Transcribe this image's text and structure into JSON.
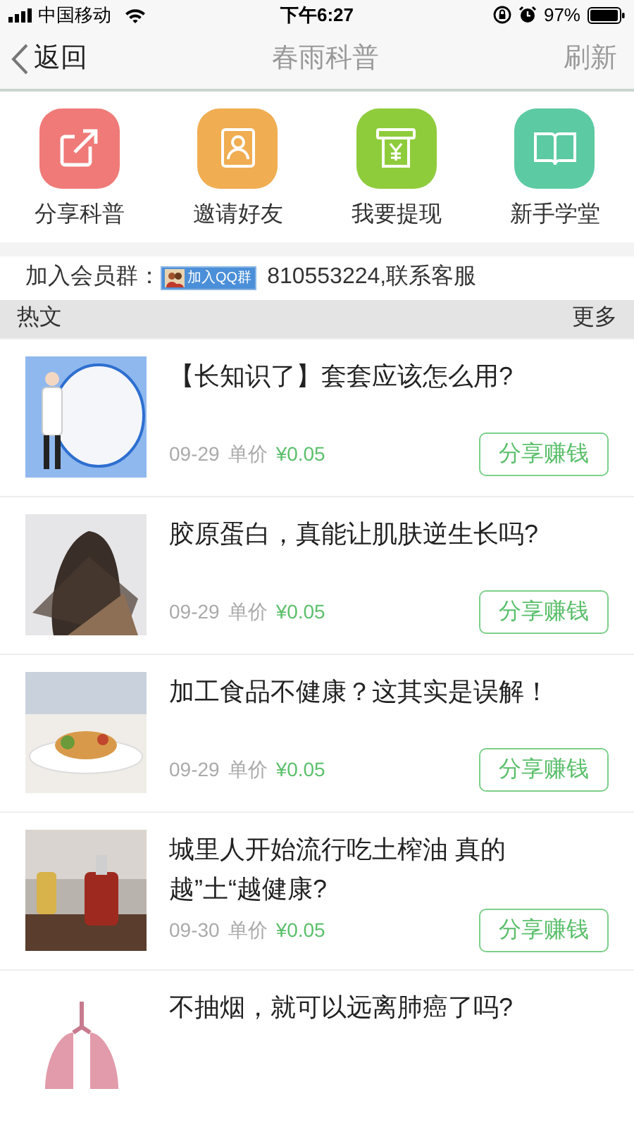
{
  "status_bar": {
    "carrier": "中国移动",
    "time": "下午6:27",
    "battery": "97%"
  },
  "nav": {
    "back": "返回",
    "title": "春雨科普",
    "action": "刷新"
  },
  "quick_actions": [
    {
      "label": "分享科普",
      "color": "#ef7a78"
    },
    {
      "label": "邀请好友",
      "color": "#f0ad52"
    },
    {
      "label": "我要提现",
      "color": "#8fcc3c"
    },
    {
      "label": "新手学堂",
      "color": "#5ccaa3"
    }
  ],
  "member_group": {
    "label": "加入会员群：",
    "badge": "加入QQ群",
    "text": "810553224,联系客服"
  },
  "section": {
    "title": "热文",
    "more": "更多"
  },
  "articles": [
    {
      "title": "【长知识了】套套应该怎么用?",
      "date": "09-29",
      "price_label": "单价",
      "price": "¥0.05",
      "button": "分享赚钱"
    },
    {
      "title": "胶原蛋白，真能让肌肤逆生长吗?",
      "date": "09-29",
      "price_label": "单价",
      "price": "¥0.05",
      "button": "分享赚钱"
    },
    {
      "title": "加工食品不健康？这其实是误解！",
      "date": "09-29",
      "price_label": "单价",
      "price": "¥0.05",
      "button": "分享赚钱"
    },
    {
      "title": "城里人开始流行吃土榨油 真的越”土“越健康?",
      "date": "09-30",
      "price_label": "单价",
      "price": "¥0.05",
      "button": "分享赚钱"
    },
    {
      "title": "不抽烟，就可以远离肺癌了吗?"
    }
  ]
}
